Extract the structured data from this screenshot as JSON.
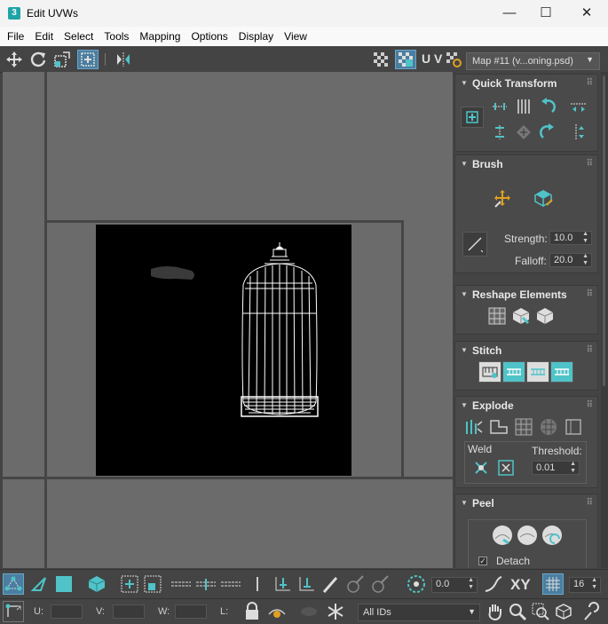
{
  "window": {
    "title": "Edit UVWs",
    "app_icon_label": "3",
    "minimize": "—",
    "maximize": "☐",
    "close": "✕"
  },
  "menu": [
    "File",
    "Edit",
    "Select",
    "Tools",
    "Mapping",
    "Options",
    "Display",
    "View"
  ],
  "toolbar": {
    "uv_label": "U V",
    "map_selector": "Map #11 (v...oning.psd)"
  },
  "panels": {
    "quick_transform": {
      "title": "Quick Transform"
    },
    "brush": {
      "title": "Brush",
      "strength_label": "Strength:",
      "strength_value": "10.0",
      "falloff_label": "Falloff:",
      "falloff_value": "20.0"
    },
    "reshape": {
      "title": "Reshape Elements"
    },
    "stitch": {
      "title": "Stitch"
    },
    "explode": {
      "title": "Explode",
      "weld_label": "Weld",
      "threshold_label": "Threshold:",
      "threshold_value": "0.01"
    },
    "peel": {
      "title": "Peel",
      "detach_label": "Detach",
      "detach_checked": true
    }
  },
  "bottom": {
    "angle_value": "0.0",
    "xy_label": "XY",
    "grid_value": "16",
    "u_label": "U:",
    "v_label": "V:",
    "w_label": "W:",
    "l_label": "L:",
    "id_filter": "All IDs"
  },
  "colors": {
    "accent": "#4fc3c8",
    "viewport": "#6b6b6b",
    "canvas": "#000000",
    "wire": "#ffffff"
  }
}
